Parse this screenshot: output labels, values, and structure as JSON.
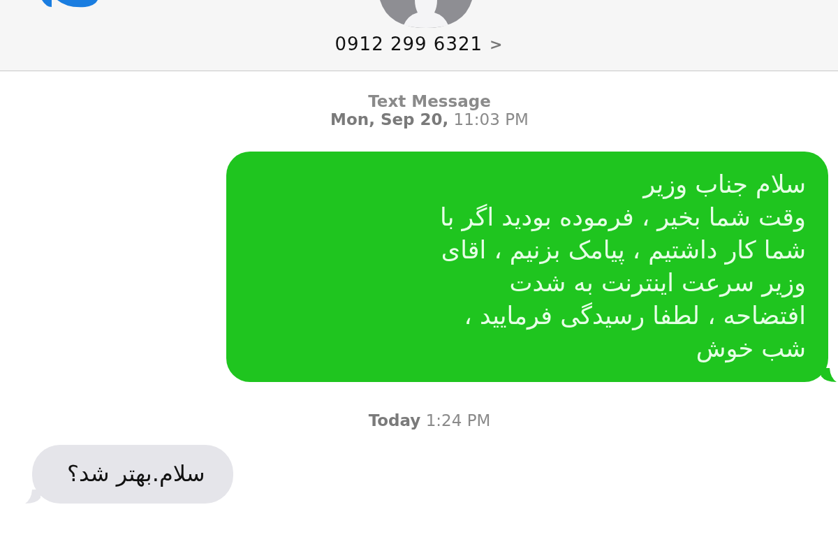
{
  "header": {
    "contact": "0912 299 6321",
    "chevron": ">"
  },
  "messages": [
    {
      "kind": "timestamp",
      "title": "Text Message",
      "time": "**Mon, Sep 20,** 11:03 PM"
    },
    {
      "kind": "sent",
      "text": "سلام جناب وزیر\nوقت شما بخیر ، فرموده بودید اگر با\nشما کار داشتیم ، پیامک بزنیم ، اقای\nوزیر سرعت اینترنت به شدت\nافتضاحه ، لطفا رسیدگی فرمایید ،\nشب خوش"
    },
    {
      "kind": "timestamp",
      "time": "**Today** 1:24 PM"
    },
    {
      "kind": "received",
      "text": "سلام.بهتر شد؟"
    }
  ]
}
